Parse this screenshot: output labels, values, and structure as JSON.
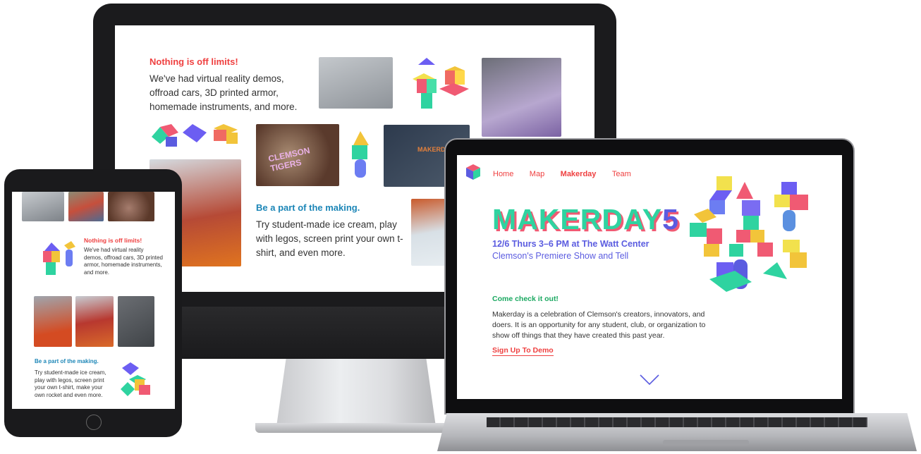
{
  "desktop": {
    "sections": [
      {
        "heading": "Nothing is off limits!",
        "body": "We've had virtual reality demos, offroad cars, 3D printed armor, homemade instruments, and more."
      },
      {
        "heading": "Be a part of the making.",
        "body": "Try student-made ice cream, play with legos, screen print your own t-shirt, and even more."
      }
    ],
    "photos": [
      {
        "label": "3D printed figures",
        "color": "#9a9ea3"
      },
      {
        "label": "hands soldering",
        "color": "#6b5c82"
      },
      {
        "label": "CLEMSON TIGERS screen",
        "color": "#5a3a2c"
      },
      {
        "label": "MAKERDAY t-shirt",
        "color": "#3a4a5c"
      },
      {
        "label": "screen printing",
        "color": "#d24a1e"
      },
      {
        "label": "air hockey",
        "color": "#c9d6de"
      }
    ],
    "shirt_text": "MAKERDAY",
    "screen_text": "CLEMSON TIGERS"
  },
  "tablet": {
    "sections": [
      {
        "heading": "Nothing is off limits!",
        "body": "We've had virtual reality demos, offroad cars, 3D printed armor, homemade instruments, and more."
      },
      {
        "heading": "Be a part of the making.",
        "body": "Try student-made ice cream, play with legos, screen print your own t-shirt, make your own rocket and even more."
      }
    ]
  },
  "laptop": {
    "nav": [
      "Home",
      "Map",
      "Makerday",
      "Team"
    ],
    "active_nav": "Makerday",
    "hero": {
      "title": "MAKERDAY",
      "title_num": "5",
      "date_line": "12/6 Thurs 3–6 PM at The Watt Center",
      "subtitle": "Clemson's Premiere Show and Tell"
    },
    "intro": {
      "heading": "Come check it out!",
      "body": "Makerday is a celebration of Clemson's creators, innovators, and doers.  It is an opportunity for any student, club, or organization to show off things that they have created this past year.",
      "cta": "Sign Up To Demo"
    }
  },
  "colors": {
    "red": "#ef4040",
    "blue": "#1c86b7",
    "purple": "#5b5ce0",
    "teal": "#2fd3a0"
  }
}
